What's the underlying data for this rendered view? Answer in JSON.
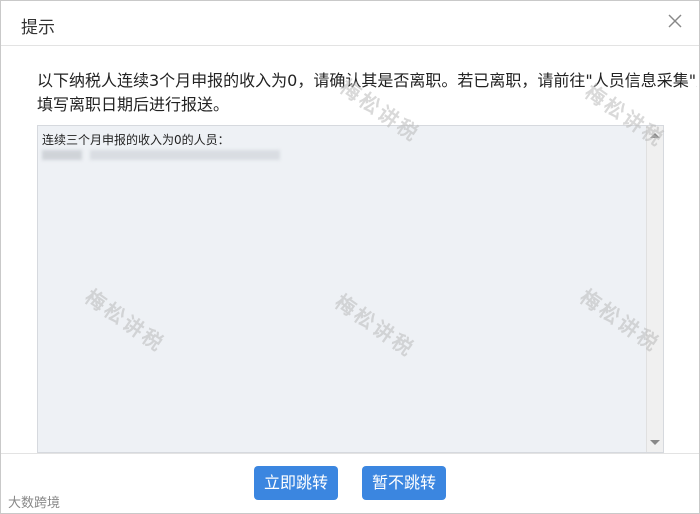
{
  "dialog": {
    "title": "提示",
    "close_icon": "close-icon",
    "message_line1": "以下纳税人连续3个月申报的收入为0，请确认其是否离职。若已离职，请前往\"人员信息采集\"菜",
    "message_line2": "填写离职日期后进行报送。",
    "textbox": {
      "header": "连续三个月申报的收入为0的人员："
    },
    "buttons": {
      "jump": "立即跳转",
      "skip": "暂不跳转"
    }
  },
  "watermark": "梅松讲税",
  "corner_logo": "大数跨境",
  "colors": {
    "button": "#3b86e0",
    "textbox_bg": "#eef1f5"
  }
}
